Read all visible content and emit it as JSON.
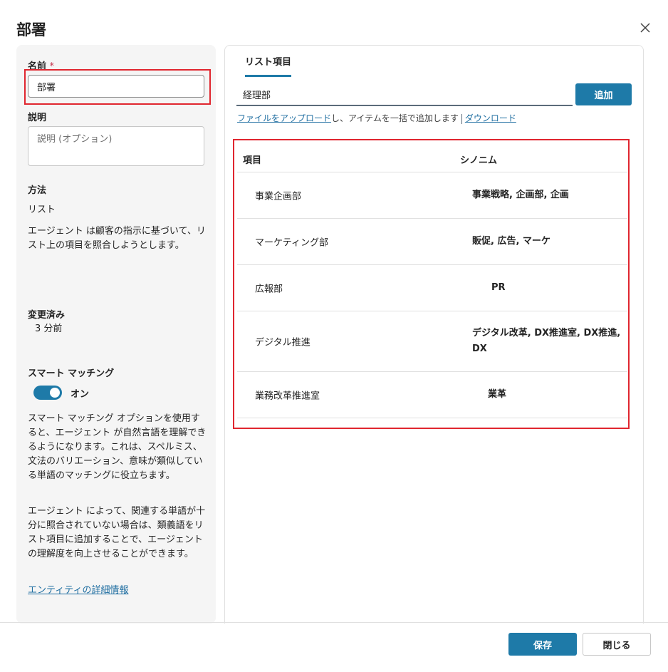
{
  "dialog": {
    "title": "部署",
    "close_icon": "close-icon"
  },
  "left": {
    "name_label": "名前",
    "required_mark": "*",
    "name_value": "部署",
    "description_label": "説明",
    "description_placeholder": "説明 (オプション)",
    "method_label": "方法",
    "method_value": "リスト",
    "method_description": "エージェント は顧客の指示に基づいて、リスト上の項目を照合しようとします。",
    "modified_label": "変更済み",
    "modified_value": "3 分前",
    "smart_matching_label": "スマート マッチング",
    "smart_matching_state": "オン",
    "smart_matching_desc1": "スマート マッチング オプションを使用すると、エージェント が自然言語を理解できるようになります。これは、スペルミス、文法のバリエーション、意味が類似している単語のマッチングに役立ちます。",
    "smart_matching_desc2": "エージェント によって、関連する単語が十分に照合されていない場合は、類義語をリスト項目に追加することで、エージェント の理解度を向上させることができます。",
    "entity_link": "エンティティの詳細情報"
  },
  "right": {
    "tab": "リスト項目",
    "item_input_value": "経理部",
    "add_button": "追加",
    "upload_link": "ファイルをアップロード",
    "upload_text": "し、アイテムを一括で追加します",
    "download_link": "ダウンロード",
    "table": {
      "headers": [
        "項目",
        "シノニム"
      ],
      "rows": [
        {
          "item": "事業企画部",
          "synonyms": "事業戦略, 企画部, 企画"
        },
        {
          "item": "マーケティング部",
          "synonyms": "販促, 広告, マーケ"
        },
        {
          "item": "広報部",
          "synonyms": "PR"
        },
        {
          "item": "デジタル推進",
          "synonyms": "デジタル改革, DX推進室, DX推進, DX"
        },
        {
          "item": "業務改革推進室",
          "synonyms": "業革"
        }
      ]
    }
  },
  "footer": {
    "save_button": "保存",
    "close_button": "閉じる"
  },
  "colors": {
    "accent": "#1e7aa8",
    "highlight": "#e0262f"
  }
}
